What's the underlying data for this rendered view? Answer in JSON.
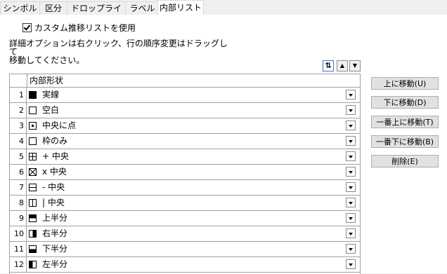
{
  "tabs": [
    {
      "label": "シンボル",
      "active": false
    },
    {
      "label": "区分",
      "active": false
    },
    {
      "label": "ドロップライン",
      "active": false
    },
    {
      "label": "ラベル",
      "active": false
    },
    {
      "label": "内部リスト",
      "active": true
    }
  ],
  "use_custom": {
    "label": "カスタム推移リストを使用",
    "checked": true
  },
  "help_text": [
    "詳細オプションは右クリック、行の順序変更はドラッグして",
    "移動してください。"
  ],
  "mini_buttons": {
    "sort": "⇅",
    "up": "▲",
    "down": "▼"
  },
  "grid": {
    "header": "内部形状",
    "rows": [
      {
        "num": "1",
        "icon": "solid-square-icon",
        "label": "実線"
      },
      {
        "num": "2",
        "icon": "hollow-square-icon",
        "label": "空白"
      },
      {
        "num": "3",
        "icon": "center-dot-square-icon",
        "label": "中央に点"
      },
      {
        "num": "4",
        "icon": "frame-only-square-icon",
        "label": "枠のみ"
      },
      {
        "num": "5",
        "icon": "plus-center-square-icon",
        "label": "+ 中央"
      },
      {
        "num": "6",
        "icon": "x-center-square-icon",
        "label": "x 中央"
      },
      {
        "num": "7",
        "icon": "minus-center-square-icon",
        "label": "- 中央"
      },
      {
        "num": "8",
        "icon": "bar-center-square-icon",
        "label": "| 中央"
      },
      {
        "num": "9",
        "icon": "top-half-square-icon",
        "label": "上半分"
      },
      {
        "num": "10",
        "icon": "right-half-square-icon",
        "label": "右半分"
      },
      {
        "num": "11",
        "icon": "bottom-half-square-icon",
        "label": "下半分"
      },
      {
        "num": "12",
        "icon": "left-half-square-icon",
        "label": "左半分"
      }
    ]
  },
  "side_buttons": {
    "move_up": "上に移動(U)",
    "move_down": "下に移動(D)",
    "move_top": "一番上に移動(T)",
    "move_bottom": "一番下に移動(B)",
    "delete": "削除(E)"
  }
}
